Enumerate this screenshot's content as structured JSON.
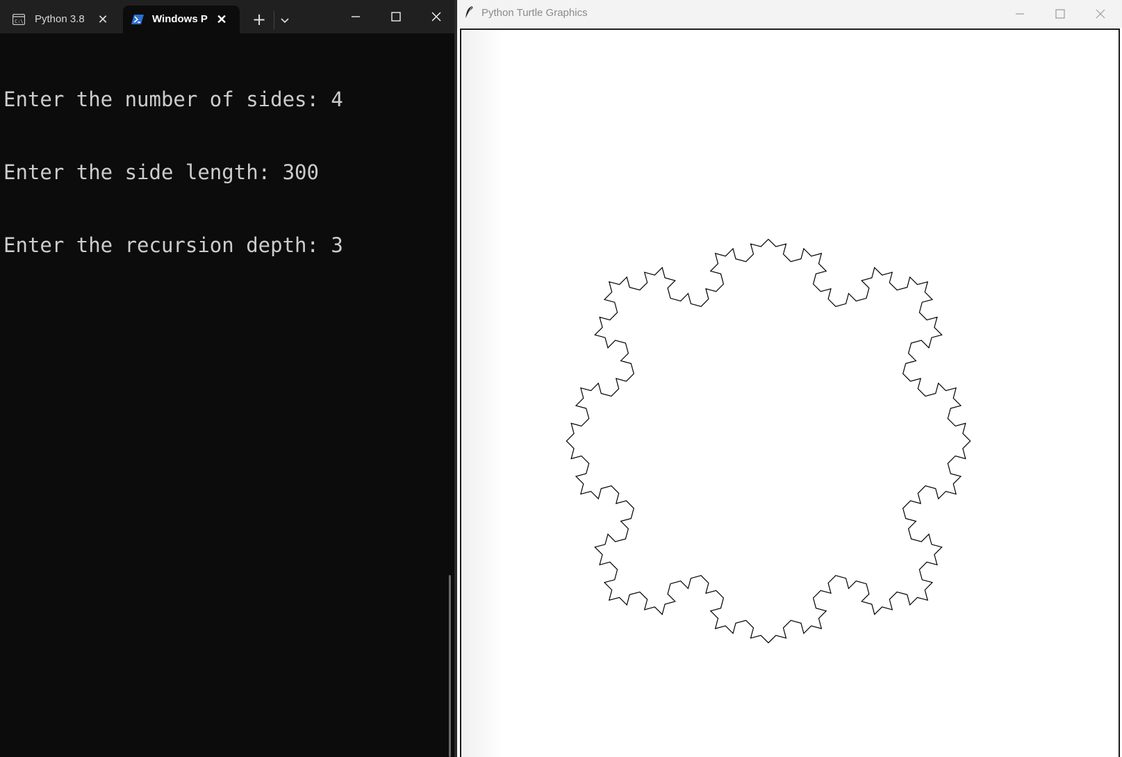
{
  "terminal": {
    "tabs": [
      {
        "label": "Python 3.8",
        "icon": "cmd-icon",
        "active": false
      },
      {
        "label": "Windows P",
        "icon": "powershell-icon",
        "active": true
      }
    ],
    "new_tab": "+",
    "close_glyph": "✕",
    "lines": [
      "Enter the number of sides: 4",
      "Enter the side length: 300",
      "Enter the recursion depth: 3"
    ],
    "colors": {
      "background": "#0c0c0c",
      "text": "#cccccc",
      "titlebar": "#202020"
    }
  },
  "turtle_window": {
    "title": "Python Turtle Graphics",
    "icon": "feather-icon",
    "drawing": {
      "sides": 4,
      "side_length": 300,
      "depth": 3,
      "color": "#000000"
    }
  }
}
